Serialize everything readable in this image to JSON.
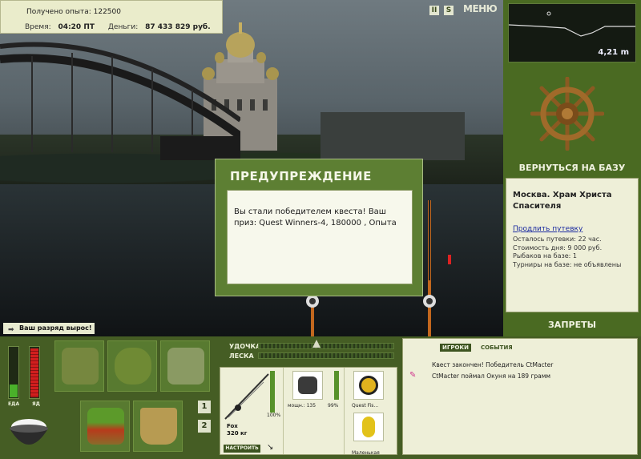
{
  "info": {
    "experience_label": "Получено опыта:",
    "experience_value": "122500",
    "time_label": "Время:",
    "time_value": "04:20 ПТ",
    "money_label": "Деньги:",
    "money_value": "87 433 829 руб."
  },
  "top_controls": {
    "pause_label": "II",
    "sound_label": "S",
    "menu_label": "МЕНЮ"
  },
  "depth": {
    "value": "4,21 m"
  },
  "right_panel": {
    "return_label": "ВЕРНУТЬСЯ НА БАЗУ",
    "location_title": "Москва. Храм Христа Спасителя",
    "extend_link": "Продлить путевку",
    "lines": [
      "Осталось путевки: 22 час.",
      "Стоимость дня: 9 000 руб.",
      "Рыбаков на базе: 1",
      "Турниры на базе: не объявлены"
    ],
    "bans_label": "ЗАПРЕТЫ"
  },
  "dialog": {
    "title": "ПРЕДУПРЕЖДЕНИЕ",
    "message": "Вы стали победителем квеста! Ваш приз: Quest Winners-4, 180000 , Опыта"
  },
  "notification": {
    "text": "Ваш разряд вырос!"
  },
  "status_bars": {
    "food_label": "ЕДА",
    "poison_label": "ЯД",
    "food_level": 0.25,
    "poison_level": 0.95
  },
  "quick_slots": {
    "slot1": "1",
    "slot2": "2"
  },
  "meters": {
    "rod_label": "УДОЧКА",
    "line_label": "ЛЕСКА"
  },
  "tackle": {
    "rod_name": "Fox",
    "rod_weight": "320 кг",
    "rod_durability": "100%",
    "reel_power": "мощн.: 135",
    "reel_durability": "99%",
    "line_name": "Quest Fis...",
    "lure_name": "Маленькая",
    "setup_label": "НАСТРОИТЬ"
  },
  "chat": {
    "tab_players": "ИГРОКИ",
    "tab_events": "СОБЫТИЯ",
    "messages": [
      "Квест закончен! Победитель CtMacter",
      "CtMacter поймал Окуня на 189 грамм"
    ]
  }
}
